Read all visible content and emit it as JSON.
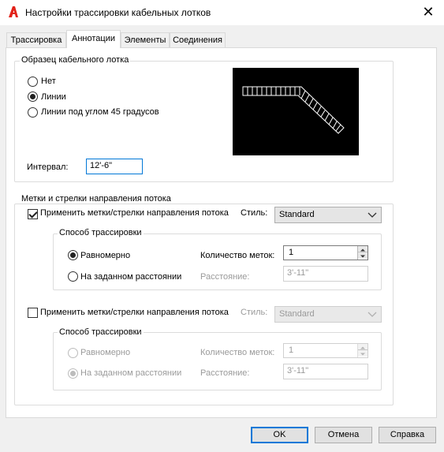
{
  "window": {
    "title": "Настройки трассировки кабельных лотков",
    "app_icon": "autocad-a-icon",
    "accent_color": "#0078d7",
    "app_icon_color": "#e2231a"
  },
  "tabs": [
    {
      "label": "Трассировка",
      "active": false
    },
    {
      "label": "Аннотации",
      "active": true
    },
    {
      "label": "Элементы",
      "active": false
    },
    {
      "label": "Соединения",
      "active": false
    }
  ],
  "sample": {
    "group_label": "Образец кабельного лотка",
    "options": [
      {
        "label": "Нет",
        "checked": false
      },
      {
        "label": "Линии",
        "checked": true
      },
      {
        "label": "Линии под углом 45 градусов",
        "checked": false
      }
    ],
    "interval_label": "Интервал:",
    "interval_value": "12'-6\""
  },
  "flow": {
    "group_label": "Метки и стрелки направления потока",
    "section1": {
      "apply_label": "Применить метки/стрелки направления потока",
      "apply_checked": true,
      "style_label": "Стиль:",
      "style_value": "Standard",
      "method_label": "Способ трассировки",
      "evenly_label": "Равномерно",
      "evenly_checked": true,
      "distance_label": "На заданном расстоянии",
      "distance_checked": false,
      "count_label": "Количество меток:",
      "count_value": "1",
      "dist_label": "Расстояние:",
      "dist_value": "3'-11\""
    },
    "section2": {
      "apply_label": "Применить метки/стрелки направления потока",
      "apply_checked": false,
      "style_label": "Стиль:",
      "style_value": "Standard",
      "method_label": "Способ трассировки",
      "evenly_label": "Равномерно",
      "evenly_checked": false,
      "distance_label": "На заданном расстоянии",
      "distance_checked": true,
      "count_label": "Количество меток:",
      "count_value": "1",
      "dist_label": "Расстояние:",
      "dist_value": "3'-11\""
    }
  },
  "buttons": {
    "ok": "OK",
    "cancel": "Отмена",
    "help": "Справка"
  }
}
